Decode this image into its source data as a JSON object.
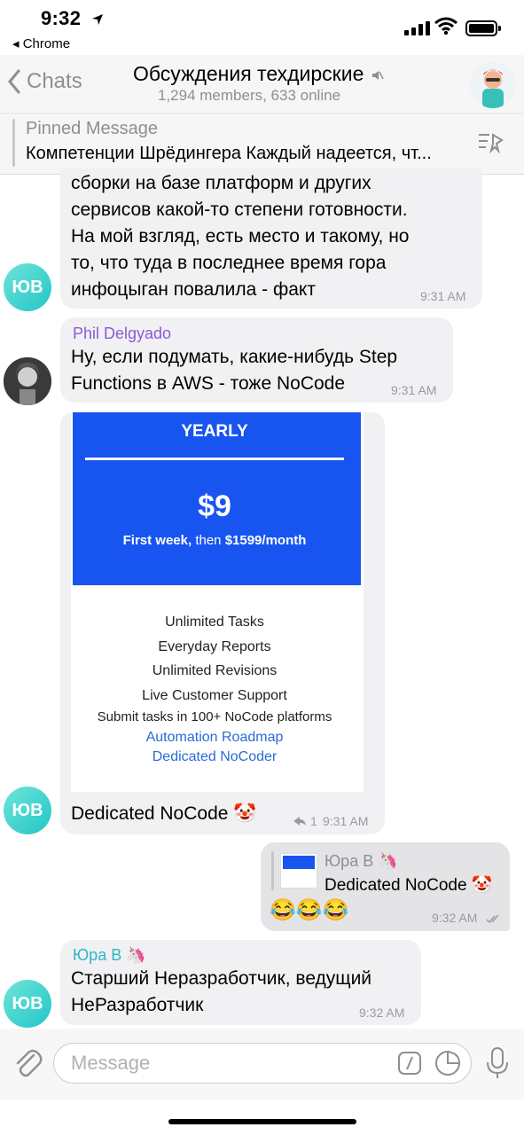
{
  "status_bar": {
    "time": "9:32",
    "back_app": "◂ Chrome"
  },
  "nav": {
    "back_label": "Chats",
    "title": "Обсуждения техдирские",
    "subtitle": "1,294 members, 633 online"
  },
  "pinned": {
    "title": "Pinned Message",
    "text": "Компетенции Шрёдингера Каждый надеется, чт..."
  },
  "messages": [
    {
      "avatar_initials": "ЮВ",
      "lines": [
        "сборки на базе платформ и других",
        "сервисов какой-то степени готовности.",
        "На мой взгляд, есть место и такому, но",
        "то, что туда в последнее время гора",
        "инфоцыган повалила - факт"
      ],
      "time": "9:31 AM"
    },
    {
      "author": "Phil Delgyado",
      "author_color": "#8b5bd4",
      "lines": [
        "Ну, если подумать, какие-нибудь Step",
        "Functions в AWS - тоже NoCode"
      ],
      "time": "9:31 AM"
    },
    {
      "avatar_initials": "ЮВ",
      "image": {
        "heading": "YEARLY",
        "price": "$9",
        "price_sub_a": "First week,",
        "price_sub_b": " then ",
        "price_sub_c": "$1599/month",
        "features": [
          "Unlimited Tasks",
          "Everyday Reports",
          "Unlimited Revisions",
          "Live Customer Support",
          "Submit tasks in 100+ NoCode platforms"
        ],
        "links": [
          "Automation Roadmap",
          "Dedicated NoCoder"
        ]
      },
      "caption": "Dedicated NoCode 🤡",
      "forwards": "1",
      "time": "9:31 AM"
    },
    {
      "outgoing": true,
      "reply_author": "Юра В 🦄",
      "reply_text": "Dedicated NoCode 🤡",
      "text": "😂😂😂",
      "time": "9:32 AM"
    },
    {
      "avatar_initials": "ЮВ",
      "author": "Юра В 🦄",
      "author_color": "#2bb8c4",
      "lines": [
        "Старший Неразработчик, ведущий",
        "НеРазработчик"
      ],
      "time": "9:32 AM"
    }
  ],
  "input": {
    "placeholder": "Message"
  },
  "colors": {
    "accent_teal": "#2bb8c4",
    "brand_blue": "#1855f0",
    "bubble_gray": "#f1f1f3"
  }
}
